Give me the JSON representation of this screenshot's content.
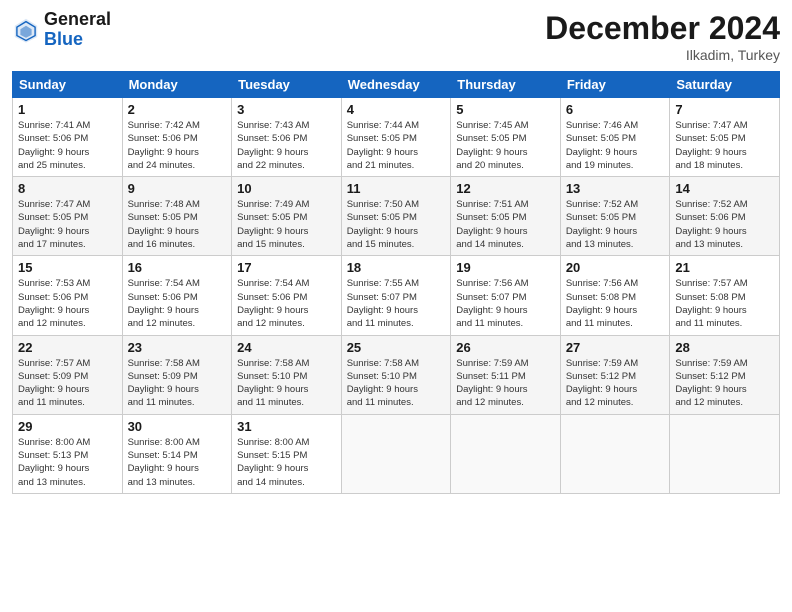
{
  "header": {
    "logo_general": "General",
    "logo_blue": "Blue",
    "title": "December 2024",
    "location": "Ilkadim, Turkey"
  },
  "weekdays": [
    "Sunday",
    "Monday",
    "Tuesday",
    "Wednesday",
    "Thursday",
    "Friday",
    "Saturday"
  ],
  "weeks": [
    [
      {
        "day": "1",
        "lines": [
          "Sunrise: 7:41 AM",
          "Sunset: 5:06 PM",
          "Daylight: 9 hours",
          "and 25 minutes."
        ]
      },
      {
        "day": "2",
        "lines": [
          "Sunrise: 7:42 AM",
          "Sunset: 5:06 PM",
          "Daylight: 9 hours",
          "and 24 minutes."
        ]
      },
      {
        "day": "3",
        "lines": [
          "Sunrise: 7:43 AM",
          "Sunset: 5:06 PM",
          "Daylight: 9 hours",
          "and 22 minutes."
        ]
      },
      {
        "day": "4",
        "lines": [
          "Sunrise: 7:44 AM",
          "Sunset: 5:05 PM",
          "Daylight: 9 hours",
          "and 21 minutes."
        ]
      },
      {
        "day": "5",
        "lines": [
          "Sunrise: 7:45 AM",
          "Sunset: 5:05 PM",
          "Daylight: 9 hours",
          "and 20 minutes."
        ]
      },
      {
        "day": "6",
        "lines": [
          "Sunrise: 7:46 AM",
          "Sunset: 5:05 PM",
          "Daylight: 9 hours",
          "and 19 minutes."
        ]
      },
      {
        "day": "7",
        "lines": [
          "Sunrise: 7:47 AM",
          "Sunset: 5:05 PM",
          "Daylight: 9 hours",
          "and 18 minutes."
        ]
      }
    ],
    [
      {
        "day": "8",
        "lines": [
          "Sunrise: 7:47 AM",
          "Sunset: 5:05 PM",
          "Daylight: 9 hours",
          "and 17 minutes."
        ]
      },
      {
        "day": "9",
        "lines": [
          "Sunrise: 7:48 AM",
          "Sunset: 5:05 PM",
          "Daylight: 9 hours",
          "and 16 minutes."
        ]
      },
      {
        "day": "10",
        "lines": [
          "Sunrise: 7:49 AM",
          "Sunset: 5:05 PM",
          "Daylight: 9 hours",
          "and 15 minutes."
        ]
      },
      {
        "day": "11",
        "lines": [
          "Sunrise: 7:50 AM",
          "Sunset: 5:05 PM",
          "Daylight: 9 hours",
          "and 15 minutes."
        ]
      },
      {
        "day": "12",
        "lines": [
          "Sunrise: 7:51 AM",
          "Sunset: 5:05 PM",
          "Daylight: 9 hours",
          "and 14 minutes."
        ]
      },
      {
        "day": "13",
        "lines": [
          "Sunrise: 7:52 AM",
          "Sunset: 5:05 PM",
          "Daylight: 9 hours",
          "and 13 minutes."
        ]
      },
      {
        "day": "14",
        "lines": [
          "Sunrise: 7:52 AM",
          "Sunset: 5:06 PM",
          "Daylight: 9 hours",
          "and 13 minutes."
        ]
      }
    ],
    [
      {
        "day": "15",
        "lines": [
          "Sunrise: 7:53 AM",
          "Sunset: 5:06 PM",
          "Daylight: 9 hours",
          "and 12 minutes."
        ]
      },
      {
        "day": "16",
        "lines": [
          "Sunrise: 7:54 AM",
          "Sunset: 5:06 PM",
          "Daylight: 9 hours",
          "and 12 minutes."
        ]
      },
      {
        "day": "17",
        "lines": [
          "Sunrise: 7:54 AM",
          "Sunset: 5:06 PM",
          "Daylight: 9 hours",
          "and 12 minutes."
        ]
      },
      {
        "day": "18",
        "lines": [
          "Sunrise: 7:55 AM",
          "Sunset: 5:07 PM",
          "Daylight: 9 hours",
          "and 11 minutes."
        ]
      },
      {
        "day": "19",
        "lines": [
          "Sunrise: 7:56 AM",
          "Sunset: 5:07 PM",
          "Daylight: 9 hours",
          "and 11 minutes."
        ]
      },
      {
        "day": "20",
        "lines": [
          "Sunrise: 7:56 AM",
          "Sunset: 5:08 PM",
          "Daylight: 9 hours",
          "and 11 minutes."
        ]
      },
      {
        "day": "21",
        "lines": [
          "Sunrise: 7:57 AM",
          "Sunset: 5:08 PM",
          "Daylight: 9 hours",
          "and 11 minutes."
        ]
      }
    ],
    [
      {
        "day": "22",
        "lines": [
          "Sunrise: 7:57 AM",
          "Sunset: 5:09 PM",
          "Daylight: 9 hours",
          "and 11 minutes."
        ]
      },
      {
        "day": "23",
        "lines": [
          "Sunrise: 7:58 AM",
          "Sunset: 5:09 PM",
          "Daylight: 9 hours",
          "and 11 minutes."
        ]
      },
      {
        "day": "24",
        "lines": [
          "Sunrise: 7:58 AM",
          "Sunset: 5:10 PM",
          "Daylight: 9 hours",
          "and 11 minutes."
        ]
      },
      {
        "day": "25",
        "lines": [
          "Sunrise: 7:58 AM",
          "Sunset: 5:10 PM",
          "Daylight: 9 hours",
          "and 11 minutes."
        ]
      },
      {
        "day": "26",
        "lines": [
          "Sunrise: 7:59 AM",
          "Sunset: 5:11 PM",
          "Daylight: 9 hours",
          "and 12 minutes."
        ]
      },
      {
        "day": "27",
        "lines": [
          "Sunrise: 7:59 AM",
          "Sunset: 5:12 PM",
          "Daylight: 9 hours",
          "and 12 minutes."
        ]
      },
      {
        "day": "28",
        "lines": [
          "Sunrise: 7:59 AM",
          "Sunset: 5:12 PM",
          "Daylight: 9 hours",
          "and 12 minutes."
        ]
      }
    ],
    [
      {
        "day": "29",
        "lines": [
          "Sunrise: 8:00 AM",
          "Sunset: 5:13 PM",
          "Daylight: 9 hours",
          "and 13 minutes."
        ]
      },
      {
        "day": "30",
        "lines": [
          "Sunrise: 8:00 AM",
          "Sunset: 5:14 PM",
          "Daylight: 9 hours",
          "and 13 minutes."
        ]
      },
      {
        "day": "31",
        "lines": [
          "Sunrise: 8:00 AM",
          "Sunset: 5:15 PM",
          "Daylight: 9 hours",
          "and 14 minutes."
        ]
      },
      {
        "day": "",
        "lines": []
      },
      {
        "day": "",
        "lines": []
      },
      {
        "day": "",
        "lines": []
      },
      {
        "day": "",
        "lines": []
      }
    ]
  ]
}
